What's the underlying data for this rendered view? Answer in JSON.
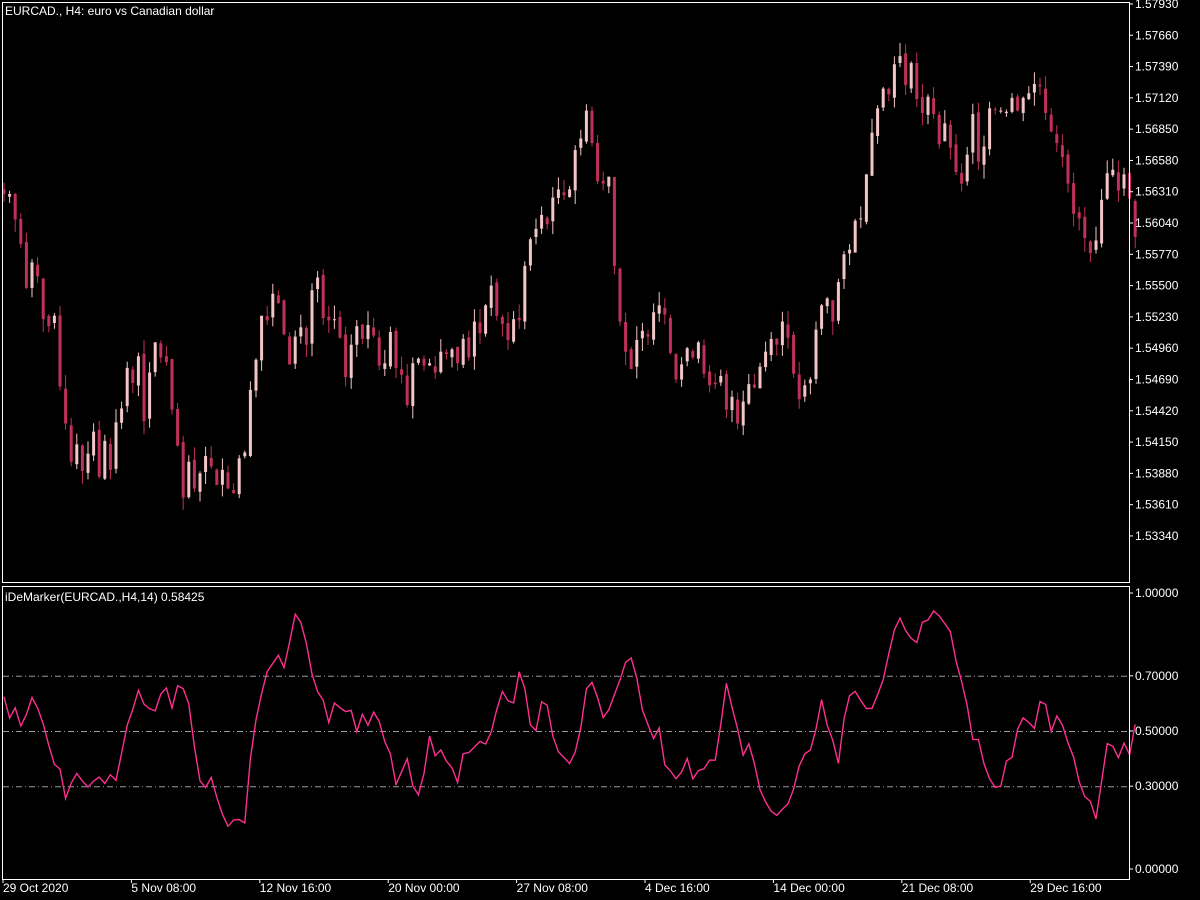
{
  "colors": {
    "background": "#000000",
    "frame": "#ffffff",
    "text": "#ffffff",
    "bull_candle": "#f2c6c6",
    "bear_candle": "#c0305a",
    "indicator_line": "#ff2f8f",
    "level_line": "#9a9a9a"
  },
  "chart_data": [
    {
      "type": "candlestick",
      "title": "EURCAD., H4:  euro vs Canadian dollar",
      "ylim": [
        1.5321,
        1.5793
      ],
      "y_ticks": [
        "1.57930",
        "1.57660",
        "1.57390",
        "1.57120",
        "1.56850",
        "1.56580",
        "1.56310",
        "1.56040",
        "1.55770",
        "1.55500",
        "1.55230",
        "1.54960",
        "1.54690",
        "1.54420",
        "1.54150",
        "1.53880",
        "1.53610",
        "1.53340"
      ],
      "series": [
        {
          "values": [
            1.5629,
            1.5629,
            1.5607,
            1.5586,
            1.5548,
            1.557,
            1.5558,
            1.5521,
            1.5515,
            1.5524,
            1.5463,
            1.5431,
            1.5398,
            1.5413,
            1.539,
            1.5405,
            1.5424,
            1.5385,
            1.5416,
            1.5391,
            1.5432,
            1.5444,
            1.5479,
            1.5466,
            1.5489,
            1.5433,
            1.5475,
            1.5501,
            1.5488,
            1.5484,
            1.5443,
            1.5412,
            1.5367,
            1.5398,
            1.5375,
            1.5388,
            1.5403,
            1.5394,
            1.5378,
            1.5391,
            1.5375,
            1.5371,
            1.5401,
            1.5406,
            1.546,
            1.5486,
            1.5524,
            1.552,
            1.5543,
            1.5535,
            1.5508,
            1.5482,
            1.5506,
            1.5514,
            1.5499,
            1.5546,
            1.5557,
            1.5522,
            1.552,
            1.5521,
            1.5505,
            1.5471,
            1.5499,
            1.5515,
            1.5504,
            1.5516,
            1.5507,
            1.5481,
            1.5483,
            1.551,
            1.5479,
            1.5473,
            1.5447,
            1.5483,
            1.5487,
            1.5481,
            1.5483,
            1.5475,
            1.5493,
            1.5491,
            1.5495,
            1.5483,
            1.5504,
            1.5488,
            1.5519,
            1.5509,
            1.5533,
            1.555,
            1.5524,
            1.5517,
            1.5503,
            1.5521,
            1.552,
            1.5567,
            1.559,
            1.5599,
            1.5611,
            1.5603,
            1.5626,
            1.5633,
            1.5628,
            1.5633,
            1.5667,
            1.5677,
            1.5701,
            1.5673,
            1.564,
            1.5638,
            1.5644,
            1.5567,
            1.5519,
            1.5493,
            1.5478,
            1.5503,
            1.5511,
            1.5506,
            1.5527,
            1.5533,
            1.5525,
            1.5492,
            1.5469,
            1.5482,
            1.5496,
            1.5488,
            1.5501,
            1.5474,
            1.5464,
            1.5465,
            1.5472,
            1.5443,
            1.5454,
            1.5431,
            1.545,
            1.5465,
            1.5462,
            1.548,
            1.5493,
            1.5504,
            1.5499,
            1.5519,
            1.5505,
            1.5474,
            1.5452,
            1.5464,
            1.5469,
            1.5512,
            1.5533,
            1.5539,
            1.5519,
            1.5553,
            1.5577,
            1.5581,
            1.5606,
            1.5608,
            1.5646,
            1.5682,
            1.5703,
            1.572,
            1.5715,
            1.5741,
            1.5748,
            1.5723,
            1.5742,
            1.5711,
            1.5699,
            1.5713,
            1.5698,
            1.5672,
            1.569,
            1.5669,
            1.5648,
            1.5638,
            1.5663,
            1.5698,
            1.5657,
            1.567,
            1.5703,
            1.5702,
            1.5701,
            1.57,
            1.5712,
            1.5701,
            1.5712,
            1.5716,
            1.5724,
            1.5722,
            1.5699,
            1.5683,
            1.5673,
            1.5661,
            1.5638,
            1.5612,
            1.5608,
            1.5591,
            1.5578,
            1.5589,
            1.5624,
            1.5647,
            1.565,
            1.5632,
            1.5646,
            1.5625,
            1.5592
          ]
        }
      ]
    },
    {
      "type": "line",
      "title": "iDeMarker(EURCAD.,H4,14) 0.58425",
      "ylim": [
        0.0,
        1.0
      ],
      "y_ticks": [
        "1.00000",
        "0.70000",
        "0.50000",
        "0.30000",
        "0.00000"
      ],
      "levels": [
        0.7,
        0.5,
        0.3
      ],
      "x_ticks": [
        "29 Oct 2020",
        "5 Nov 08:00",
        "12 Nov 16:00",
        "20 Nov 00:00",
        "27 Nov 08:00",
        "4 Dec 16:00",
        "14 Dec 00:00",
        "21 Dec 08:00",
        "29 Dec 16:00"
      ],
      "series": [
        {
          "values": [
            0.6244,
            0.547,
            0.5838,
            0.5185,
            0.5599,
            0.6213,
            0.5832,
            0.5262,
            0.4483,
            0.3791,
            0.3621,
            0.2553,
            0.3117,
            0.3461,
            0.3185,
            0.2967,
            0.3186,
            0.3329,
            0.3098,
            0.3414,
            0.3214,
            0.4201,
            0.5206,
            0.5783,
            0.6478,
            0.5975,
            0.5803,
            0.5731,
            0.6336,
            0.6557,
            0.5833,
            0.6637,
            0.6538,
            0.5983,
            0.4433,
            0.3197,
            0.2954,
            0.3314,
            0.2598,
            0.1987,
            0.1548,
            0.1773,
            0.179,
            0.1667,
            0.4003,
            0.5407,
            0.6359,
            0.7153,
            0.745,
            0.7741,
            0.7296,
            0.822,
            0.9233,
            0.894,
            0.8165,
            0.7066,
            0.6429,
            0.6117,
            0.5307,
            0.6015,
            0.5844,
            0.5702,
            0.5742,
            0.4977,
            0.5605,
            0.5211,
            0.5681,
            0.5349,
            0.4616,
            0.417,
            0.3067,
            0.3526,
            0.3995,
            0.3011,
            0.2685,
            0.3467,
            0.4818,
            0.4101,
            0.4317,
            0.3914,
            0.3666,
            0.3134,
            0.4177,
            0.4216,
            0.4417,
            0.4624,
            0.4525,
            0.4964,
            0.5779,
            0.6434,
            0.6095,
            0.6019,
            0.7144,
            0.6544,
            0.5221,
            0.5015,
            0.6059,
            0.593,
            0.4818,
            0.4245,
            0.4041,
            0.3818,
            0.424,
            0.5124,
            0.6525,
            0.6765,
            0.6207,
            0.5487,
            0.5768,
            0.6315,
            0.6853,
            0.7489,
            0.7646,
            0.6918,
            0.5765,
            0.5224,
            0.4726,
            0.5114,
            0.3772,
            0.3556,
            0.3272,
            0.3511,
            0.4008,
            0.3268,
            0.3564,
            0.3631,
            0.3947,
            0.3941,
            0.524,
            0.6723,
            0.5861,
            0.5071,
            0.4125,
            0.4538,
            0.3824,
            0.2869,
            0.2431,
            0.2099,
            0.1942,
            0.2165,
            0.2359,
            0.2896,
            0.3736,
            0.4171,
            0.4316,
            0.5069,
            0.6135,
            0.5209,
            0.4661,
            0.3825,
            0.5432,
            0.6287,
            0.6436,
            0.6097,
            0.5816,
            0.5819,
            0.6317,
            0.6855,
            0.7805,
            0.8663,
            0.9096,
            0.864,
            0.8356,
            0.8208,
            0.8943,
            0.902,
            0.9347,
            0.917,
            0.8891,
            0.8596,
            0.7542,
            0.6797,
            0.5918,
            0.4696,
            0.4688,
            0.3813,
            0.3267,
            0.2954,
            0.3002,
            0.3911,
            0.4048,
            0.5069,
            0.5474,
            0.5307,
            0.5093,
            0.6069,
            0.5964,
            0.4977,
            0.5544,
            0.5212,
            0.457,
            0.4052,
            0.3155,
            0.2622,
            0.2448,
            0.181,
            0.3174,
            0.4544,
            0.4447,
            0.4036,
            0.4562,
            0.414,
            0.5238
          ]
        }
      ]
    }
  ]
}
